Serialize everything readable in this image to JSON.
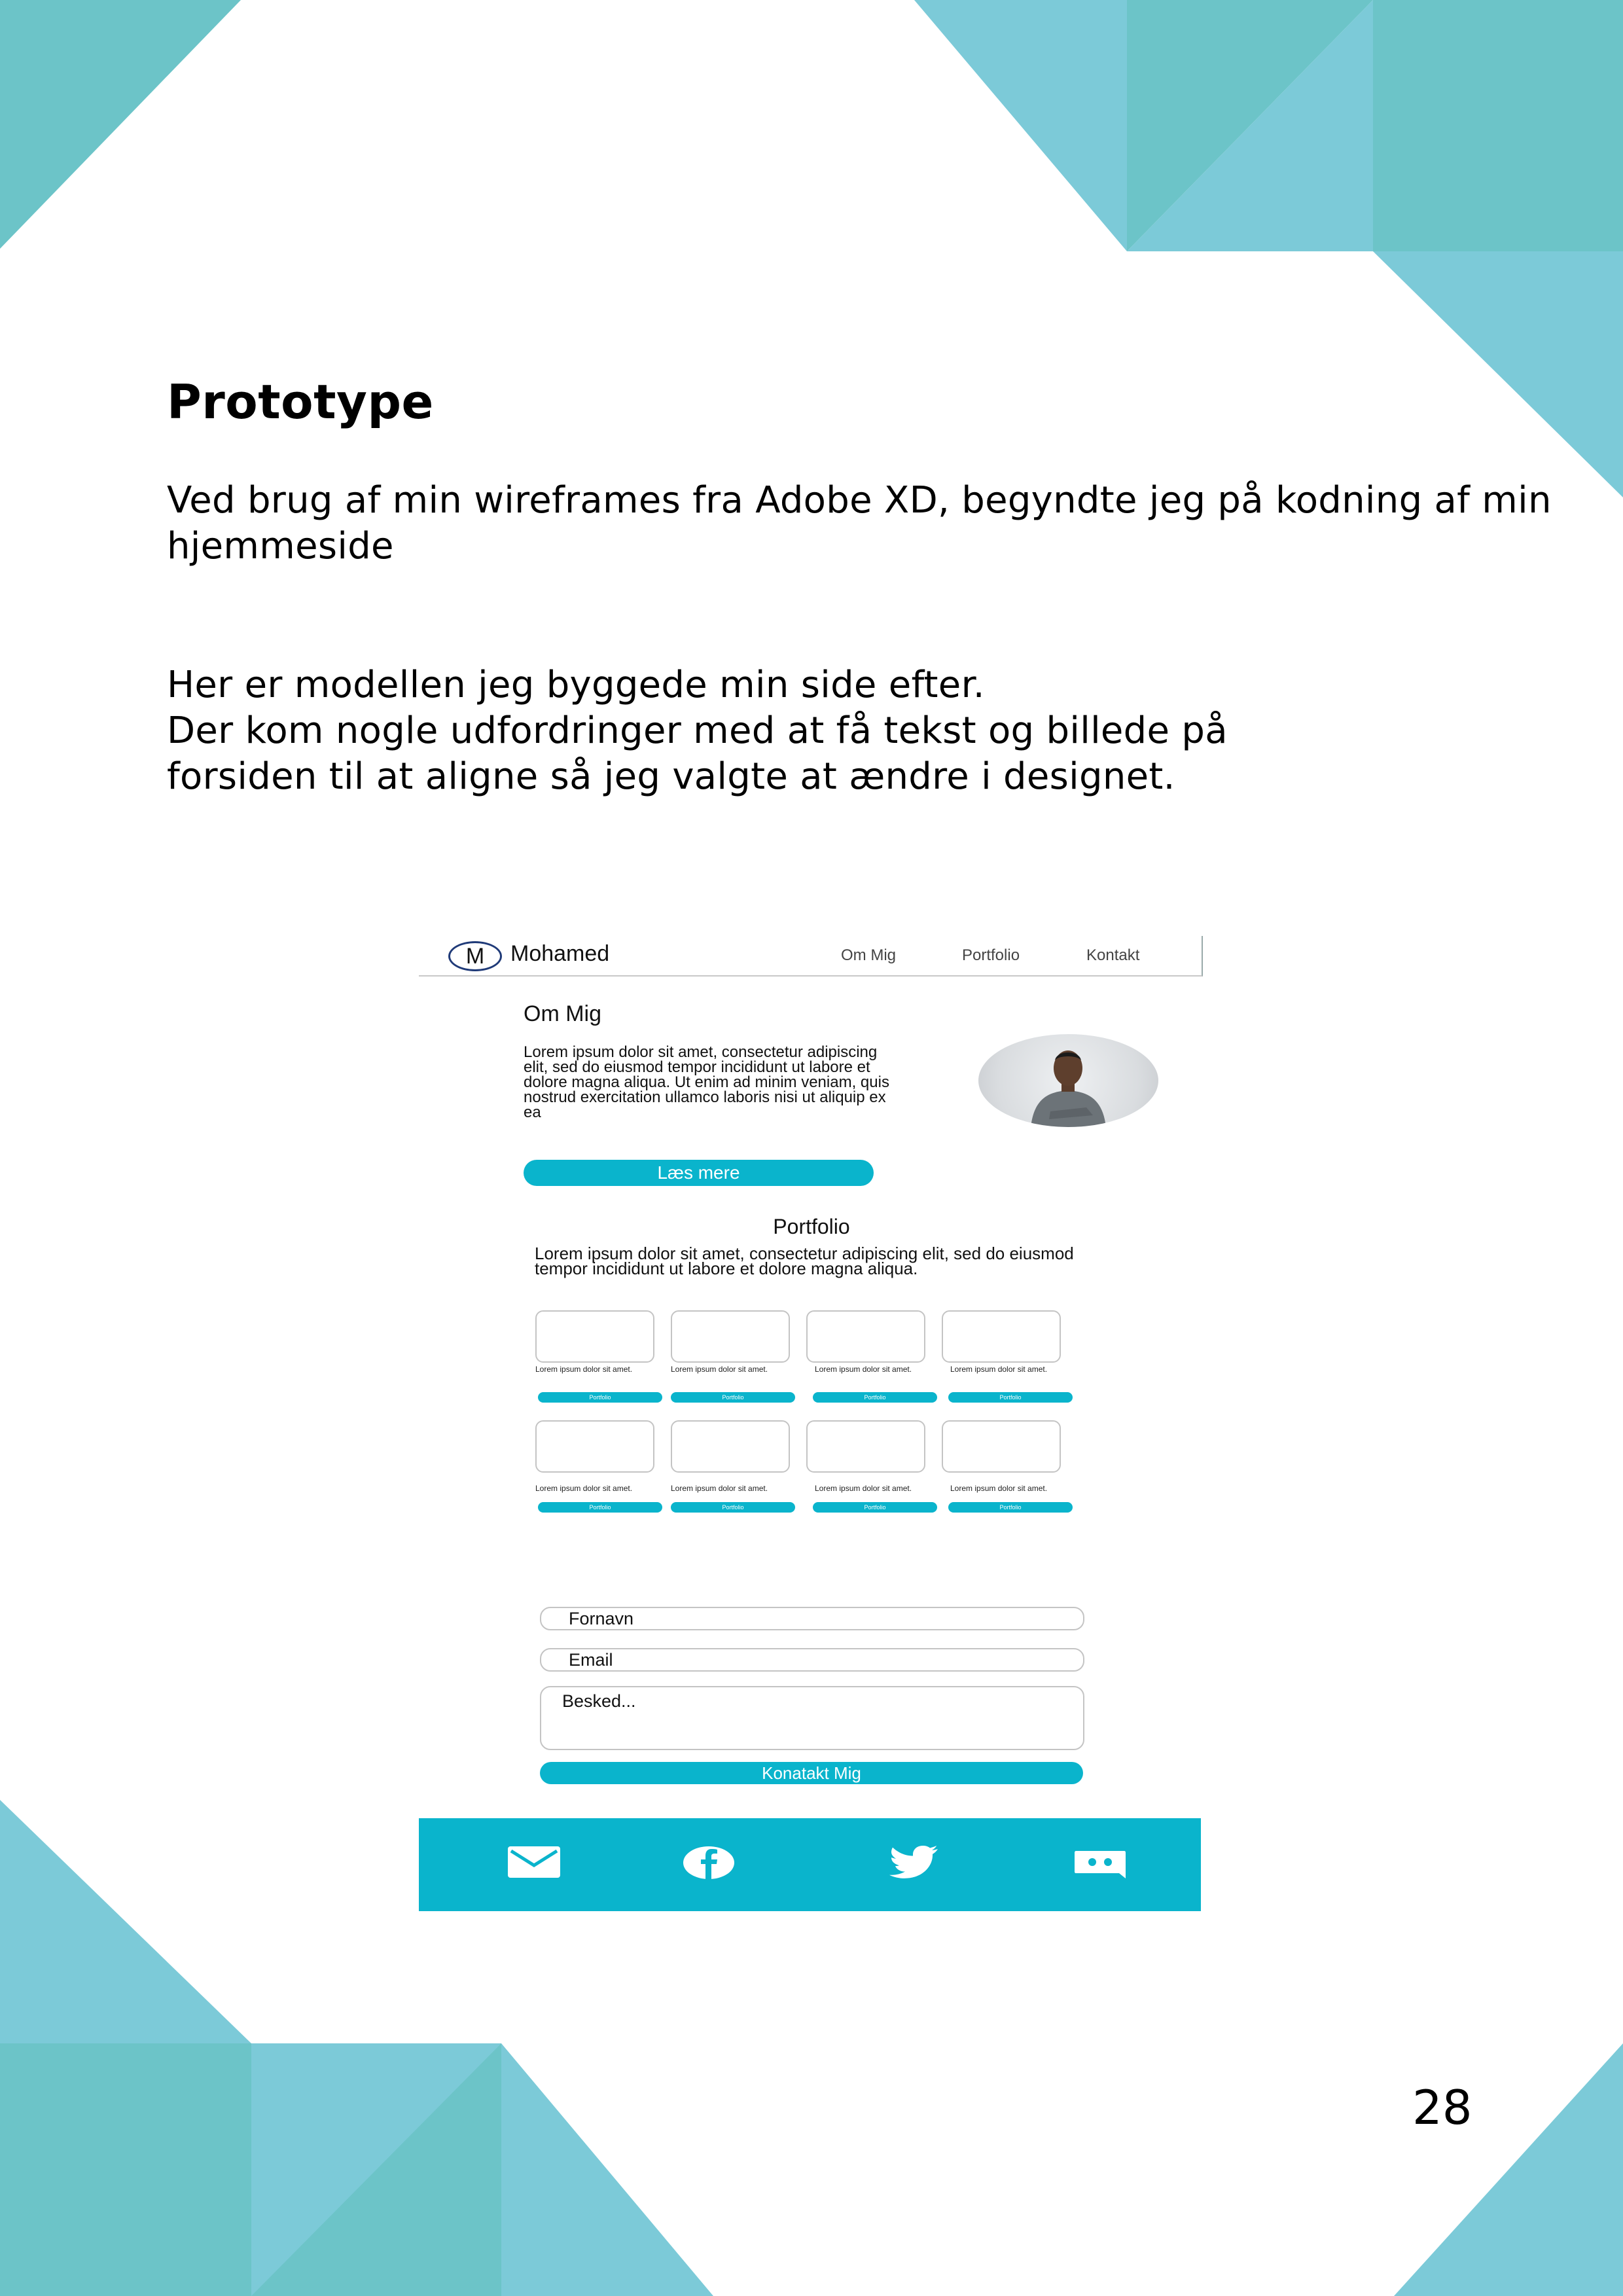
{
  "page": {
    "heading": "Prototype",
    "paragraph1": "Ved brug af min wireframes fra Adobe XD, begyndte jeg på kodning af min hjemmeside",
    "paragraph2_line1": "Her er modellen jeg byggede min side efter.",
    "paragraph2_line2": "Der kom nogle udfordringer med at få tekst og billede på forsiden til at aligne så jeg valgte at ændre i designet.",
    "page_number": "28"
  },
  "colors": {
    "teal": "#6cc4c8",
    "light_blue": "#7ccad8",
    "accent": "#0ab4cc"
  },
  "mockup": {
    "logo_letter": "M",
    "brand": "Mohamed",
    "nav": [
      "Om Mig",
      "Portfolio",
      "Kontakt"
    ],
    "about_title": "Om Mig",
    "about_text": "Lorem ipsum dolor sit amet, consectetur adipiscing elit, sed do eiusmod tempor incididunt ut labore et dolore magna aliqua. Ut enim ad minim veniam, quis nostrud exercitation ullamco laboris nisi ut aliquip ex ea",
    "read_more": "Læs mere",
    "portfolio_title": "Portfolio",
    "portfolio_text": "Lorem ipsum dolor sit amet, consectetur adipiscing elit, sed do eiusmod tempor incididunt ut labore et dolore magna aliqua.",
    "card_text": "Lorem ipsum dolor sit amet.",
    "card_button": "Portfolio",
    "form": {
      "name_placeholder": "Fornavn",
      "email_placeholder": "Email",
      "message_placeholder": "Besked...",
      "submit": "Konatakt Mig"
    },
    "footer_icons": [
      "mail-icon",
      "facebook-icon",
      "twitter-icon",
      "discord-icon"
    ]
  }
}
